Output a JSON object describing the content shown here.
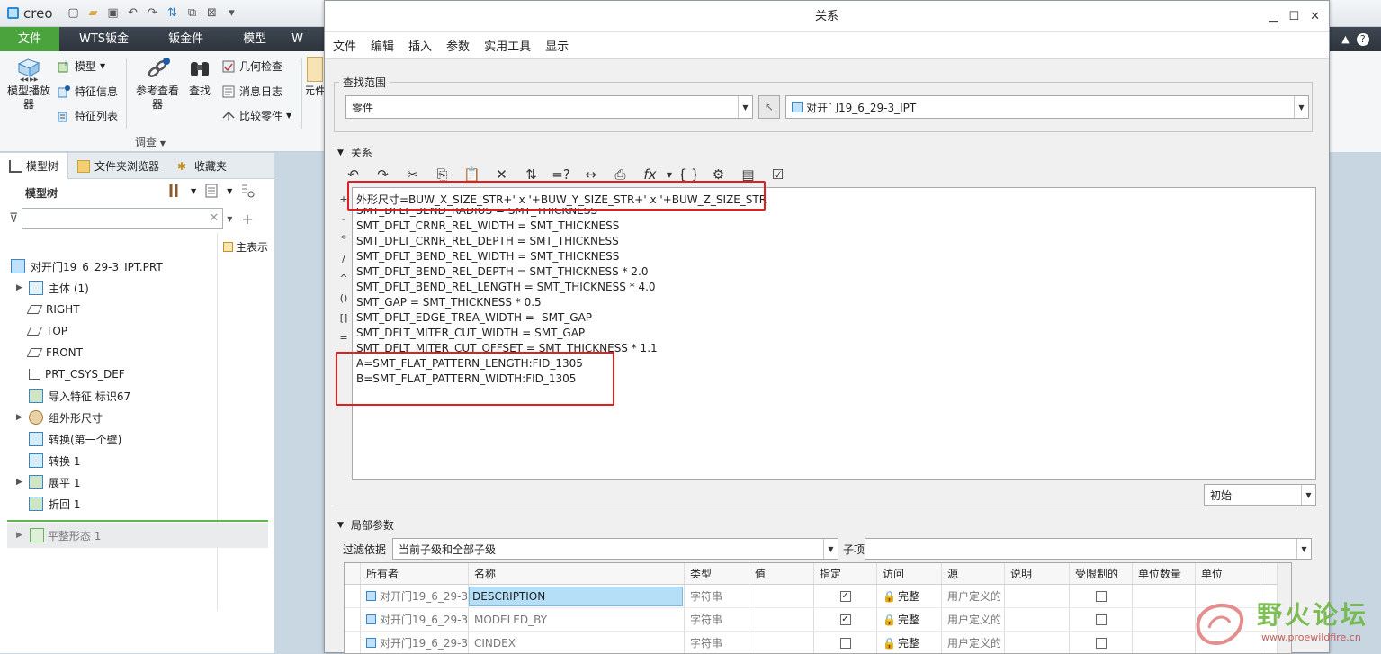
{
  "app": {
    "logo": "creo",
    "menu_tabs": [
      "文件",
      "WTS钣金",
      "钣金件",
      "模型",
      "W"
    ],
    "ribbon": {
      "model_playback": "模型播放器",
      "model": "模型",
      "feature_info": "特征信息",
      "feature_list": "特征列表",
      "ref_viewer": "参考查看器",
      "find": "查找",
      "geometry_check": "几何检查",
      "message_log": "消息日志",
      "compare_part": "比较零件",
      "investigate": "调查",
      "yuan": "元件"
    }
  },
  "left_panel": {
    "tabs": [
      "模型树",
      "文件夹浏览器",
      "收藏夹"
    ],
    "tree_title": "模型树",
    "filter_value": "",
    "main_show": "主表示",
    "items": [
      {
        "label": "对开门19_6_29-3_IPT.PRT"
      },
      {
        "label": "主体 (1)"
      },
      {
        "label": "RIGHT"
      },
      {
        "label": "TOP"
      },
      {
        "label": "FRONT"
      },
      {
        "label": "PRT_CSYS_DEF"
      },
      {
        "label": "导入特征 标识67"
      },
      {
        "label": "组外形尺寸"
      },
      {
        "label": "转换(第一个壁)"
      },
      {
        "label": "转换 1"
      },
      {
        "label": "展平 1"
      },
      {
        "label": "折回 1"
      }
    ],
    "flat_state": "平整形态 1"
  },
  "dialog": {
    "title": "关系",
    "menu": [
      "文件",
      "编辑",
      "插入",
      "参数",
      "实用工具",
      "显示"
    ],
    "search_scope_label": "查找范围",
    "scope_type": "零件",
    "scope_object": "对开门19_6_29-3_IPT",
    "relations_label": "关系",
    "operators": [
      "+",
      "-",
      "*",
      "/",
      "^",
      "()",
      "[]",
      "="
    ],
    "relations": [
      "外形尺寸=BUW_X_SIZE_STR+' x '+BUW_Y_SIZE_STR+' x '+BUW_Z_SIZE_STR",
      "SMT_DFLT_BEND_RADIUS = SMT_THICKNESS",
      "SMT_DFLT_CRNR_REL_WIDTH = SMT_THICKNESS",
      "SMT_DFLT_CRNR_REL_DEPTH = SMT_THICKNESS",
      "SMT_DFLT_BEND_REL_WIDTH = SMT_THICKNESS",
      "SMT_DFLT_BEND_REL_DEPTH = SMT_THICKNESS * 2.0",
      "SMT_DFLT_BEND_REL_LENGTH = SMT_THICKNESS * 4.0",
      "SMT_GAP = SMT_THICKNESS * 0.5",
      "SMT_DFLT_EDGE_TREA_WIDTH = -SMT_GAP",
      "SMT_DFLT_MITER_CUT_WIDTH = SMT_GAP",
      "SMT_DFLT_MITER_CUT_OFFSET = SMT_THICKNESS * 1.1",
      "A=SMT_FLAT_PATTERN_LENGTH:FID_1305",
      "B=SMT_FLAT_PATTERN_WIDTH:FID_1305"
    ],
    "initial_combo": "初始",
    "local_params_label": "局部参数",
    "filter_by_label": "过滤依据",
    "filter_by_value": "当前子级和全部子级",
    "child_label": "子项",
    "child_value": "",
    "param_columns": [
      "所有者",
      "名称",
      "类型",
      "值",
      "指定",
      "访问",
      "源",
      "说明",
      "受限制的",
      "单位数量",
      "单位"
    ],
    "params": [
      {
        "owner": "对开门19_6_29-3_",
        "name": "DESCRIPTION",
        "type": "字符串",
        "value": "",
        "designated": "✓",
        "access": "完整",
        "source": "用户定义的",
        "desc": "",
        "restricted": ""
      },
      {
        "owner": "对开门19_6_29-3_",
        "name": "MODELED_BY",
        "type": "字符串",
        "value": "",
        "designated": "✓",
        "access": "完整",
        "source": "用户定义的",
        "desc": "",
        "restricted": ""
      },
      {
        "owner": "对开门19_6_29-3_",
        "name": "CINDEX",
        "type": "字符串",
        "value": "",
        "designated": "",
        "access": "完整",
        "source": "用户定义的",
        "desc": "",
        "restricted": ""
      }
    ]
  },
  "watermark": {
    "title": "野火论坛",
    "url": "www.proewildfire.cn"
  }
}
